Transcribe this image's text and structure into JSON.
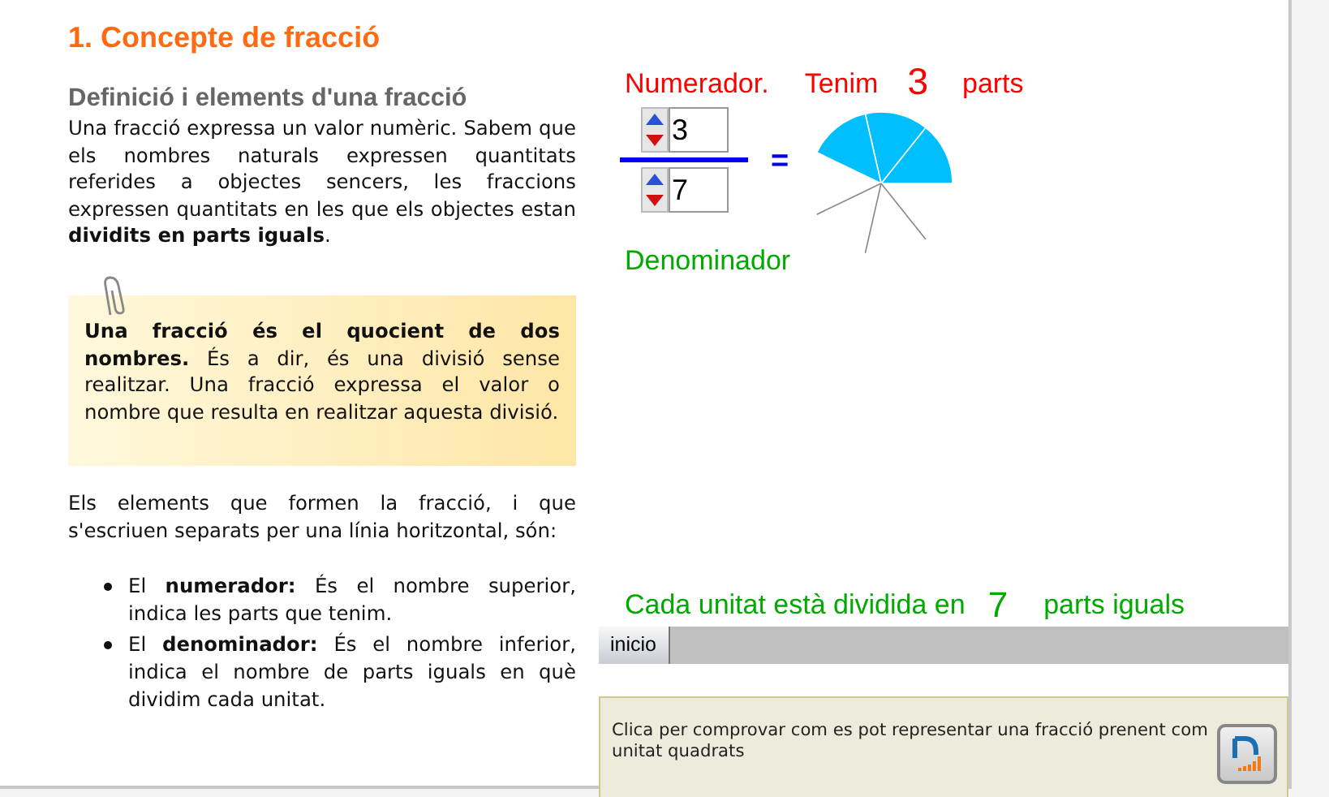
{
  "title": "1. Concepte de fracció",
  "left": {
    "subtitle": "Definició i elements d'una fracció",
    "intro": "Una fracció expressa un valor numèric. Sabem que els nombres naturals expressen quantitats referides a objectes sencers, les fraccions expressen quantitats en les que els objectes estan **dividits en parts iguals**.",
    "note": "**Una fracció és el quocient de dos nombres.** És a dir, és una divisió sense realitzar. Una fracció expressa el valor o nombre que resulta en realitzar aquesta divisió.",
    "elements_intro": "Els elements que formen la fracció, i que s'escriuen separats per una línia horitzontal, són:",
    "bullets": [
      "El **numerador:** És el nombre superior, indica les parts que tenim.",
      "El **denominador:** És el nombre inferior, indica el nombre de parts iguals en què dividim cada unitat."
    ]
  },
  "applet": {
    "numerator_label": "Numerador.",
    "have_label": "Tenim",
    "have_value": "3",
    "parts_label": "parts",
    "numerator": "3",
    "denominator": "7",
    "equals": "=",
    "denominator_label": "Denominador",
    "unit_prefix": "Cada unitat està dividida en",
    "unit_value": "7",
    "unit_suffix": "parts iguals",
    "start_button": "inicio"
  },
  "info": {
    "text": "Clica per comprovar com es pot representar una fracció prenent com unitat quadrats"
  }
}
